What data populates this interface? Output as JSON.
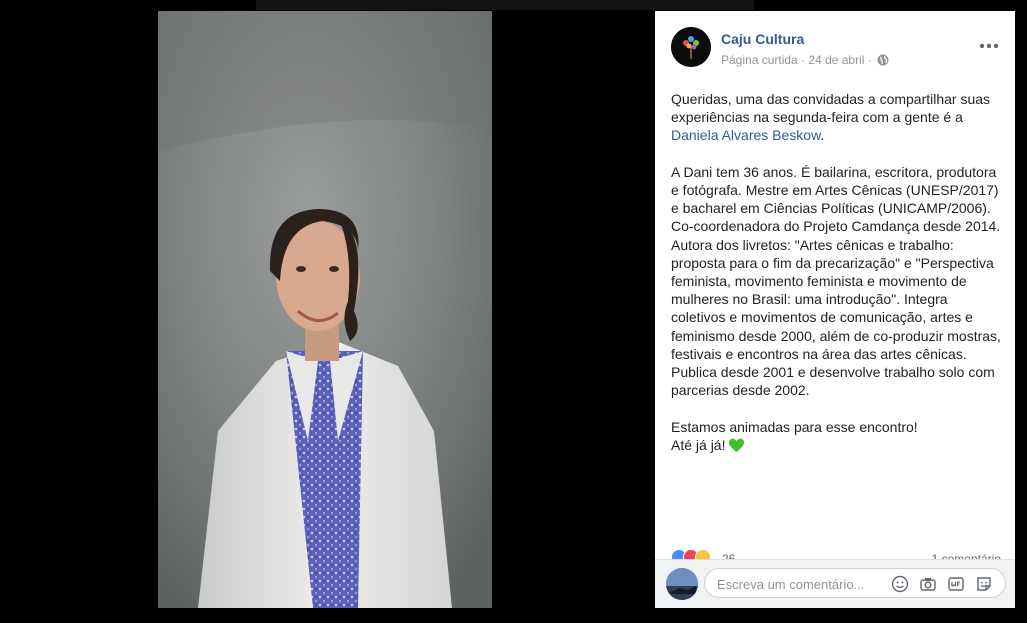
{
  "photo": {
    "description_icon": "portrait-photo"
  },
  "post": {
    "page_name": "Caju Cultura",
    "meta_status": "Página curtida",
    "separator": " · ",
    "date": "24 de abril",
    "paragraph1_text": "Queridas, uma das convidadas a compartilhar suas experiências na segunda-feira com a gente é a ",
    "mention": "Daniela Alvares Beskow",
    "paragraph1_end": ".",
    "paragraph2": "A Dani tem 36 anos. É bailarina, escritora, produtora e fotógrafa. Mestre em Artes Cênicas (UNESP/2017) e bacharel em Ciências Políticas (UNICAMP/2006). Co-coordenadora do Projeto Camdança desde 2014. Autora dos livretos: \"Artes cênicas e trabalho: proposta para o fim da precarização\" e \"Perspectiva feminista, movimento feminista e movimento de mulheres no Brasil: uma introdução\". Integra coletivos e movimentos de comunicação, artes e feminismo desde 2000, além de co-produzir mostras, festivais e encontros na área das artes cênicas. Publica desde 2001 e desenvolve trabalho solo com parcerias desde 2002.",
    "paragraph3_line1": "Estamos animadas para esse encontro!",
    "paragraph3_line2": "Até já já!"
  },
  "reactions": {
    "count": "26",
    "comments": "1 comentário",
    "types": [
      "like",
      "love",
      "wow"
    ]
  },
  "comment_box": {
    "placeholder": "Escreva um comentário..."
  },
  "colors": {
    "link": "#365899",
    "meta": "#90949c",
    "text": "#1d2129",
    "heart": "#44bd32"
  }
}
